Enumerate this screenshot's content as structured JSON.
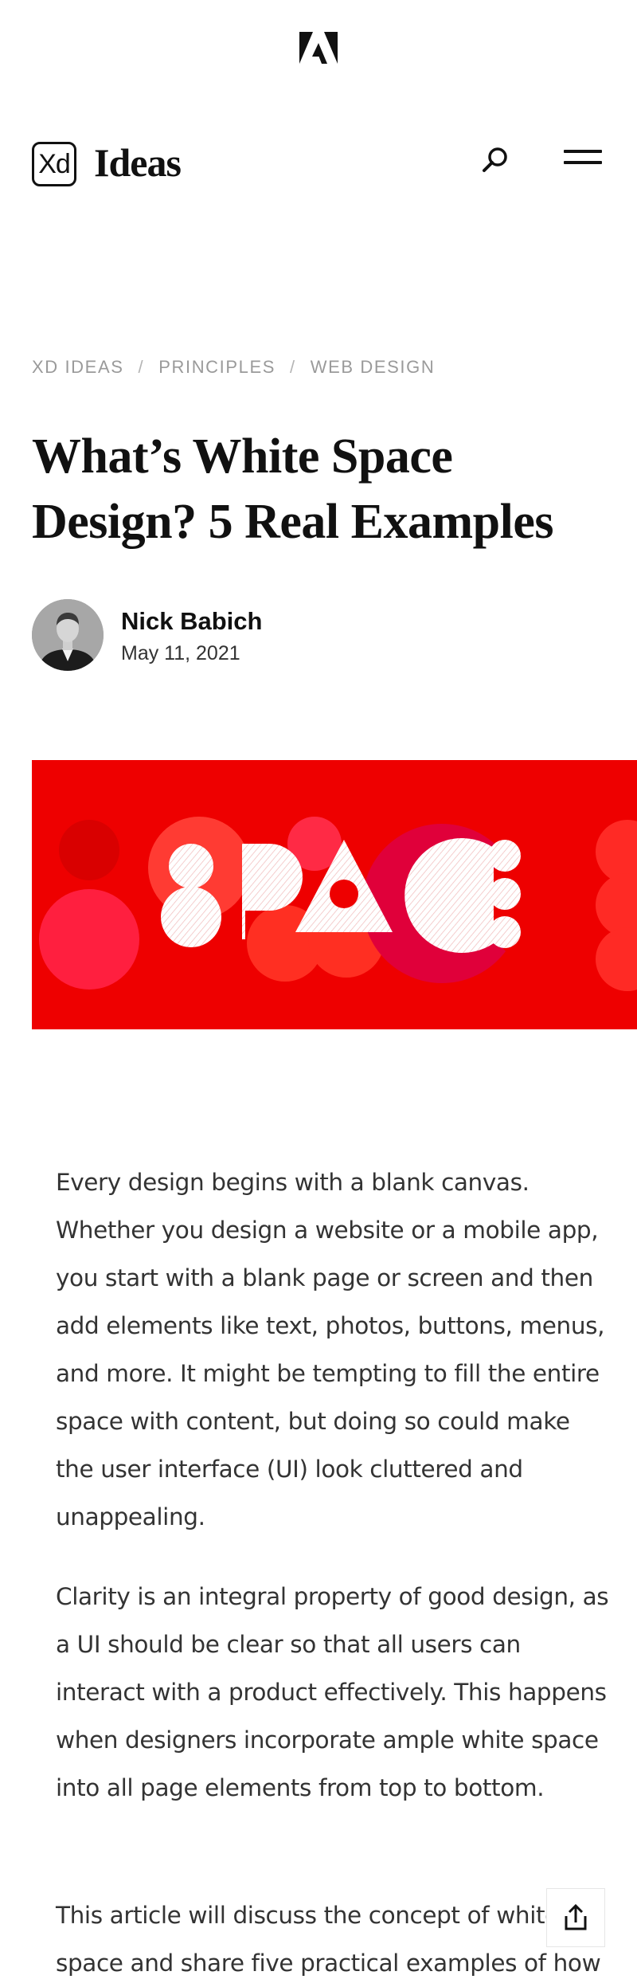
{
  "header": {
    "logo_text": "Xd",
    "brand": "Ideas"
  },
  "breadcrumb": [
    "XD IDEAS",
    "PRINCIPLES",
    "WEB DESIGN"
  ],
  "article": {
    "title": "What’s White Space Design? 5 Real Examples",
    "author": "Nick Babich",
    "date": "May 11, 2021",
    "hero_alt_text": "SPACE",
    "paragraphs": [
      "Every design begins with a blank canvas. Whether you design a website or a mobile app, you start with a blank page or screen and then add elements like text, photos, buttons, menus, and more. It might be tempting to fill the entire space with content, but doing so could make the user interface (UI) look cluttered and unappealing.",
      "Clarity is an integral property of good design, as a UI should be clear so that all users can interact with a product effectively. This happens when designers incorporate ample white space into all page elements from top to bottom.",
      "This article will discuss the concept of white space and share five practical examples of how"
    ]
  },
  "colors": {
    "hero_background": "#ee0000",
    "text": "#333333",
    "muted": "#9a9a9a"
  },
  "icons": [
    "adobe-logo-icon",
    "search-icon",
    "hamburger-menu-icon",
    "share-icon"
  ]
}
